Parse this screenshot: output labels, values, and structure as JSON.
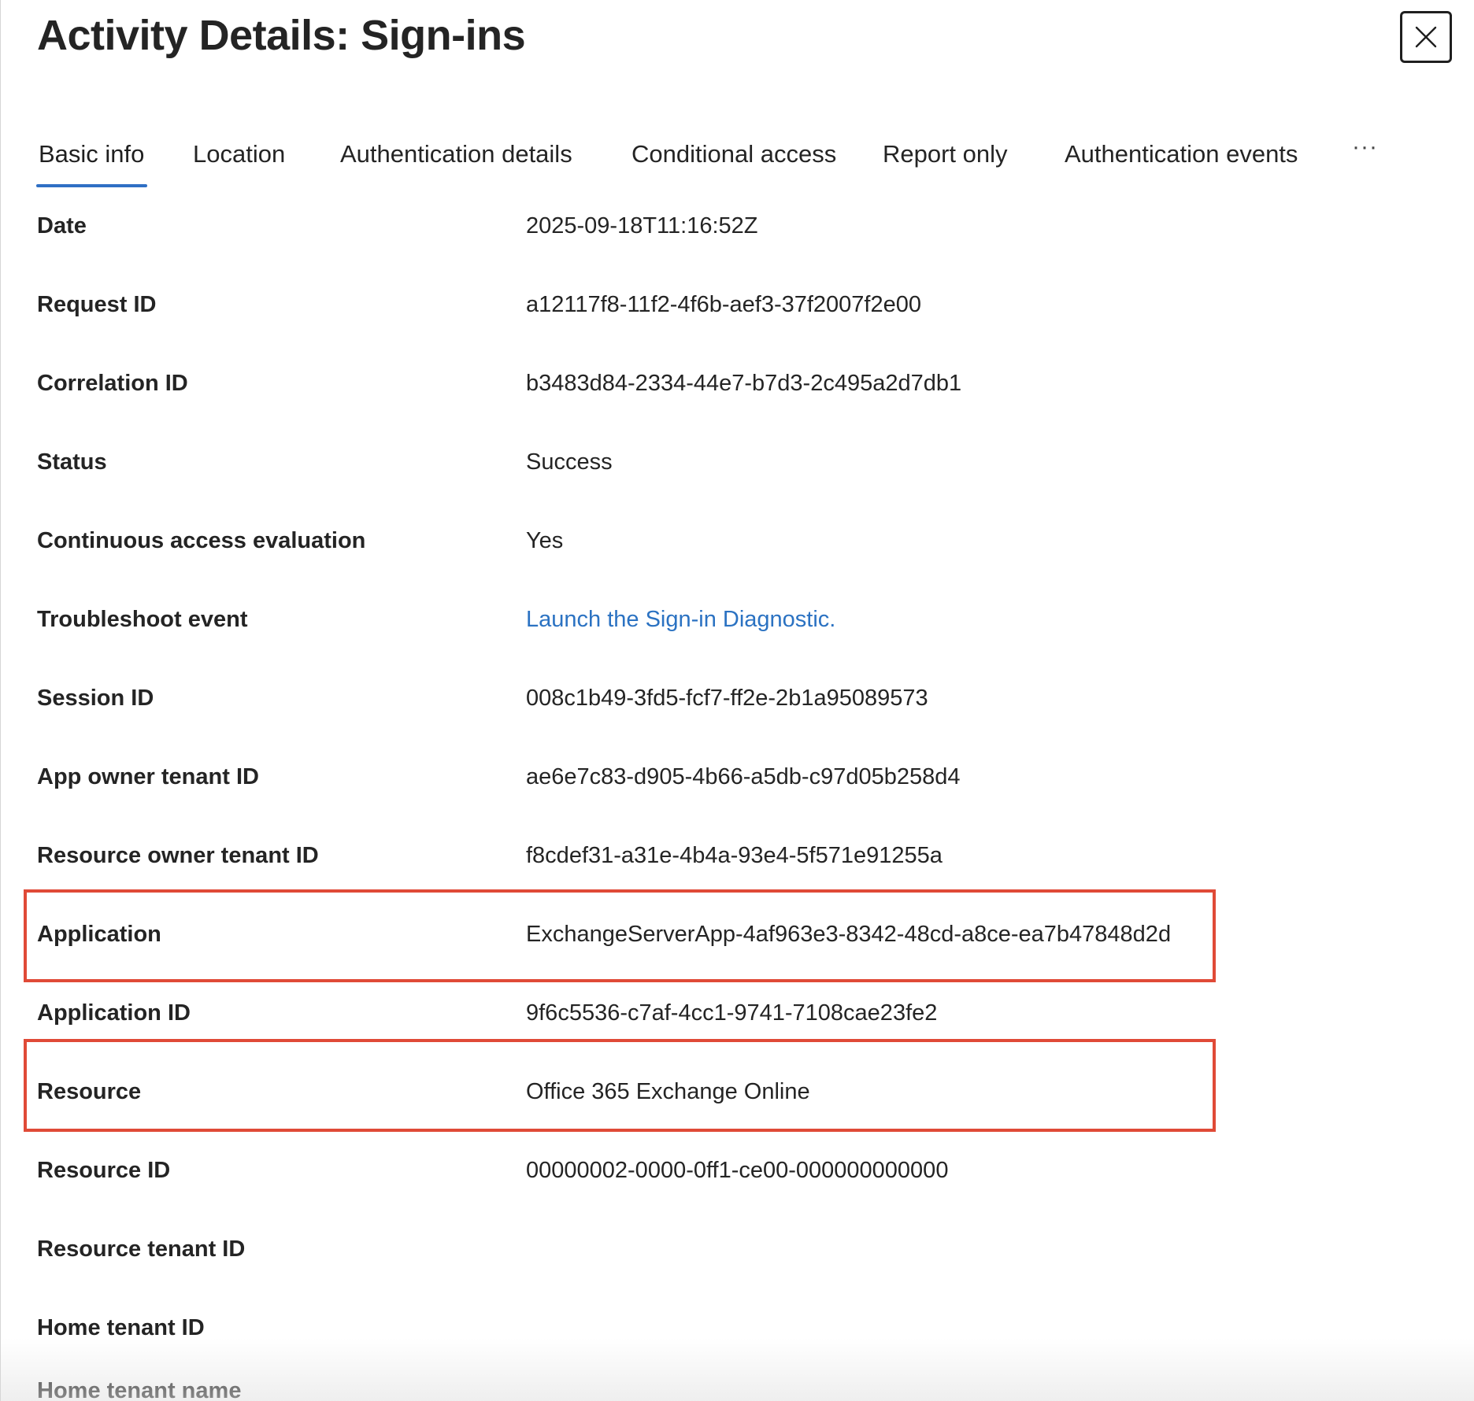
{
  "panel": {
    "title": "Activity Details: Sign-ins",
    "close_icon": "close-icon"
  },
  "tabs": [
    {
      "label": "Basic info",
      "active": true
    },
    {
      "label": "Location",
      "active": false
    },
    {
      "label": "Authentication details",
      "active": false
    },
    {
      "label": "Conditional access",
      "active": false
    },
    {
      "label": "Report only",
      "active": false
    },
    {
      "label": "Authentication events",
      "active": false
    }
  ],
  "more_tabs": "···",
  "details": [
    {
      "label": "Date",
      "value": "2025-09-18T11:16:52Z"
    },
    {
      "label": "Request ID",
      "value": "a12117f8-11f2-4f6b-aef3-37f2007f2e00"
    },
    {
      "label": "Correlation ID",
      "value": "b3483d84-2334-44e7-b7d3-2c495a2d7db1"
    },
    {
      "label": "Status",
      "value": "Success"
    },
    {
      "label": "Continuous access evaluation",
      "value": "Yes"
    },
    {
      "label": "Troubleshoot event",
      "value": "Launch the Sign-in Diagnostic.",
      "is_link": true
    },
    {
      "label": "Session ID",
      "value": "008c1b49-3fd5-fcf7-ff2e-2b1a95089573"
    },
    {
      "label": "App owner tenant ID",
      "value": "ae6e7c83-d905-4b66-a5db-c97d05b258d4"
    },
    {
      "label": "Resource owner tenant ID",
      "value": "f8cdef31-a31e-4b4a-93e4-5f571e91255a"
    },
    {
      "label": "Application",
      "value": "ExchangeServerApp-4af963e3-8342-48cd-a8ce-ea7b47848d2d",
      "highlighted": true
    },
    {
      "label": "Application ID",
      "value": "9f6c5536-c7af-4cc1-9741-7108cae23fe2"
    },
    {
      "label": "Resource",
      "value": "Office 365 Exchange Online",
      "highlighted": true
    },
    {
      "label": "Resource ID",
      "value": "00000002-0000-0ff1-ce00-000000000000"
    },
    {
      "label": "Resource tenant ID",
      "value": ""
    },
    {
      "label": "Home tenant ID",
      "value": ""
    },
    {
      "label": "Home tenant name",
      "value": ""
    }
  ],
  "colors": {
    "accent": "#2f6fc4",
    "link": "#2b72c2",
    "highlight_border": "#e04a37"
  }
}
